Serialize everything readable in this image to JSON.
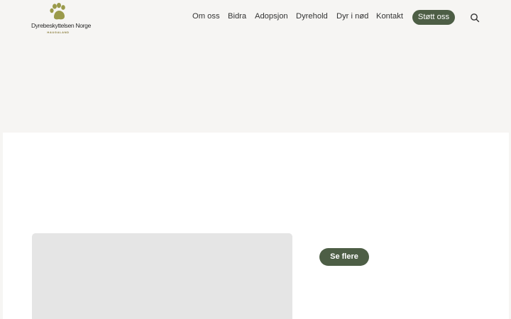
{
  "brand": {
    "name": "Dyrebeskyttelsen Norge",
    "subtitle": "HAUGALAND",
    "logo_icon": "paw-icon",
    "accent_color": "#4d5e45",
    "logo_color": "#9a9a4a"
  },
  "nav": {
    "items": [
      "Om oss",
      "Bidra",
      "Adopsjon",
      "Dyrehold",
      "Dyr i nød",
      "Kontakt"
    ],
    "cta": "Støtt oss",
    "search_icon": "search-icon"
  },
  "main": {
    "more_button": "Se flere"
  }
}
